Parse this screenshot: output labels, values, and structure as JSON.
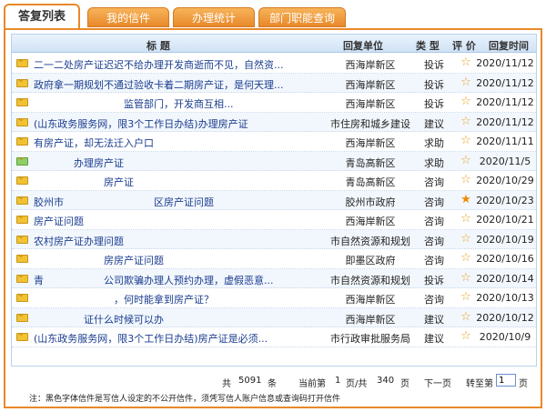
{
  "tabs": [
    {
      "label": "答复列表",
      "active": true
    },
    {
      "label": "我的信件",
      "active": false
    },
    {
      "label": "办理统计",
      "active": false
    },
    {
      "label": "部门职能查询",
      "active": false
    }
  ],
  "table": {
    "headers": {
      "title": "标 题",
      "unit": "回复单位",
      "type": "类 型",
      "rating": "评 价",
      "time": "回复时间"
    },
    "rows": [
      {
        "icon": "envelope",
        "title": "二一二处房产证迟迟不给办理开发商逝而不见，自然资...",
        "unit": "西海岸新区",
        "type": "投诉",
        "star": "empty",
        "time": "2020/11/12"
      },
      {
        "icon": "envelope",
        "title": "政府拿一期规划不通过验收卡着二期房产证，是何天理...",
        "unit": "西海岸新区",
        "type": "投诉",
        "star": "empty",
        "time": "2020/11/12"
      },
      {
        "icon": "envelope",
        "title": "　　　　　　　　　监管部门，开发商互相...",
        "unit": "西海岸新区",
        "type": "投诉",
        "star": "empty",
        "time": "2020/11/12"
      },
      {
        "icon": "envelope",
        "title": "(山东政务服务网，限3个工作日办结)办理房产证",
        "unit": "市住房和城乡建设",
        "type": "建议",
        "star": "empty",
        "time": "2020/11/12"
      },
      {
        "icon": "envelope",
        "title": "有房产证，却无法迁入户口",
        "unit": "西海岸新区",
        "type": "求助",
        "star": "empty",
        "time": "2020/11/11"
      },
      {
        "icon": "envelope-open",
        "title": "　　　　办理房产证",
        "unit": "青岛高新区",
        "type": "求助",
        "star": "empty",
        "time": "2020/11/5"
      },
      {
        "icon": "envelope",
        "title": "　　　　　　　房产证",
        "unit": "青岛高新区",
        "type": "咨询",
        "star": "empty",
        "time": "2020/10/29"
      },
      {
        "icon": "envelope",
        "title": "胶州市　　　　　　　　　区房产证问题",
        "unit": "胶州市政府",
        "type": "咨询",
        "star": "filled",
        "time": "2020/10/23"
      },
      {
        "icon": "envelope",
        "title": "房产证问题",
        "unit": "西海岸新区",
        "type": "咨询",
        "star": "empty",
        "time": "2020/10/21"
      },
      {
        "icon": "envelope",
        "title": "农村房产证办理问题",
        "unit": "市自然资源和规划",
        "type": "咨询",
        "star": "empty",
        "time": "2020/10/19"
      },
      {
        "icon": "envelope",
        "title": "　　　　　　　房房产证问题",
        "unit": "即墨区政府",
        "type": "咨询",
        "star": "empty",
        "time": "2020/10/16"
      },
      {
        "icon": "envelope",
        "title": "青　　　　　　公司欺骗办理人预约办理，虚假恶意...",
        "unit": "市自然资源和规划",
        "type": "投诉",
        "star": "empty",
        "time": "2020/10/14"
      },
      {
        "icon": "envelope",
        "title": "　　　　　　　　，何时能拿到房产证？",
        "unit": "西海岸新区",
        "type": "咨询",
        "star": "empty",
        "time": "2020/10/13"
      },
      {
        "icon": "envelope",
        "title": "　　　　　证什么时候可以办",
        "unit": "西海岸新区",
        "type": "建议",
        "star": "empty",
        "time": "2020/10/12"
      },
      {
        "icon": "envelope",
        "title": "(山东政务服务网，限3个工作日办结)房产证是必须...",
        "unit": "市行政审批服务局",
        "type": "建议",
        "star": "empty",
        "time": "2020/10/9"
      }
    ]
  },
  "pager": {
    "total_prefix": "共",
    "total": "5091",
    "total_suffix": "条",
    "current_label": "当前第",
    "current": "1",
    "of_label": "页/共",
    "pages": "340",
    "pages_suffix": "页",
    "next": "下一页",
    "goto_label": "转至第",
    "goto_value": "1",
    "goto_suffix": "页"
  },
  "note": "注：黑色字体信件是写信人设定的不公开信件，须凭写信人账户信息或查询码打开信件",
  "colors": {
    "accent": "#e8892a",
    "header_bg": "#cfe2f5",
    "title_link": "#1a3d8f",
    "star": "#e8a21e"
  }
}
